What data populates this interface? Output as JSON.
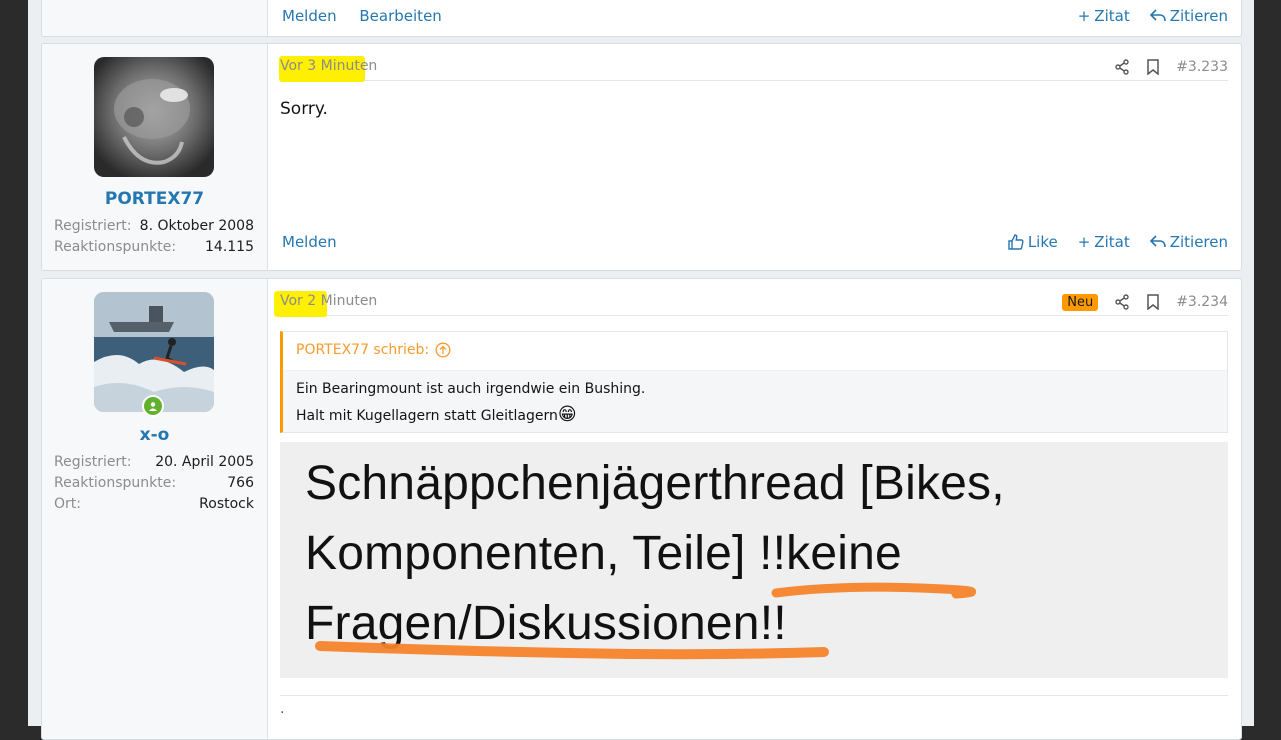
{
  "top_fragment": {
    "report": "Melden",
    "edit": "Bearbeiten",
    "quote_plus": "Zitat",
    "reply_quote": "Zitieren"
  },
  "post1": {
    "username": "PORTEX77",
    "registered_label": "Registriert:",
    "registered_value": "8. Oktober 2008",
    "reactions_label": "Reaktionspunkte:",
    "reactions_value": "14.115",
    "time": "Vor 3 Minuten",
    "number": "#3.233",
    "body": "Sorry.",
    "report": "Melden",
    "like": "Like",
    "quote_plus": "Zitat",
    "reply_quote": "Zitieren"
  },
  "post2": {
    "username": "x-o",
    "registered_label": "Registriert:",
    "registered_value": "20. April 2005",
    "reactions_label": "Reaktionspunkte:",
    "reactions_value": "766",
    "location_label": "Ort:",
    "location_value": "Rostock",
    "time": "Vor 2 Minuten",
    "new_badge": "Neu",
    "number": "#3.234",
    "quote_author": "PORTEX77 schrieb:",
    "quote_line1": "Ein Bearingmount ist auch irgendwie ein Bushing.",
    "quote_line2": "Halt mit Kugellagern statt Gleitlagern",
    "quote_emoji": "😁",
    "image_line1": "Schnäppchenjägerthread [Bikes,",
    "image_line2": "Komponenten, Teile] !!keine",
    "image_line3": "Fragen/Diskussionen!!",
    "footer_dot": "."
  },
  "colors": {
    "link": "#2577b1",
    "highlight": "#ffef00",
    "underline": "#f5832a",
    "quote_accent": "#fe9a00"
  }
}
